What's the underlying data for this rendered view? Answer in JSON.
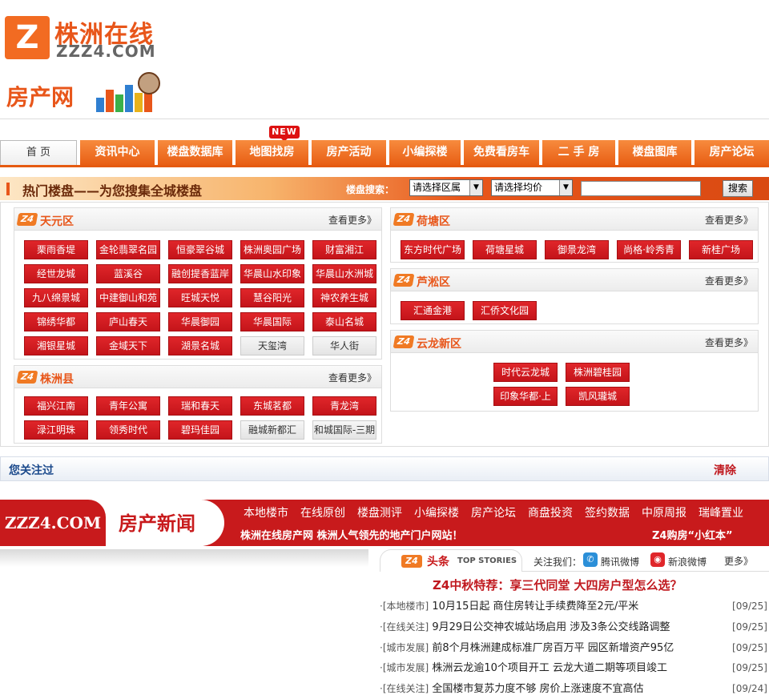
{
  "header": {
    "logo_cn": "株洲在线",
    "logo_en": "ZZZ4.COM",
    "logo_mark": "Z",
    "section_logo": "房产网"
  },
  "nav": {
    "home": "首 页",
    "new_badge": "NEW",
    "items": [
      "资讯中心",
      "楼盘数据库",
      "地图找房",
      "房产活动",
      "小编探楼",
      "免费看房车",
      "二 手 房",
      "楼盘图库",
      "房产论坛"
    ]
  },
  "hot": {
    "title": "热门楼盘——为您搜集全城楼盘",
    "search_label": "楼盘搜索：",
    "district_select": "请选择区属",
    "price_select": "请选择均价",
    "search_button": "搜索"
  },
  "districts": {
    "more_label": "查看更多》",
    "logo_mark": "Z4",
    "tianyuan": {
      "name": "天元区",
      "items": [
        {
          "label": "栗雨香堤",
          "style": "red"
        },
        {
          "label": "金轮翡翠名园",
          "style": "red"
        },
        {
          "label": "恒豪翠谷城",
          "style": "red"
        },
        {
          "label": "株洲奥园广场",
          "style": "red"
        },
        {
          "label": "财富湘江",
          "style": "red"
        },
        {
          "label": "经世龙城",
          "style": "red"
        },
        {
          "label": "蓝溪谷",
          "style": "red"
        },
        {
          "label": "融创提香蓝岸",
          "style": "red"
        },
        {
          "label": "华晨山水印象",
          "style": "red"
        },
        {
          "label": "华晨山水洲城",
          "style": "red"
        },
        {
          "label": "九八绵景城",
          "style": "red"
        },
        {
          "label": "中建御山和苑",
          "style": "red"
        },
        {
          "label": "旺城天悦",
          "style": "red"
        },
        {
          "label": "慧谷阳光",
          "style": "red"
        },
        {
          "label": "神农养生城",
          "style": "red"
        },
        {
          "label": "锦绣华都",
          "style": "red"
        },
        {
          "label": "庐山春天",
          "style": "red"
        },
        {
          "label": "华晨御园",
          "style": "red"
        },
        {
          "label": "华晨国际",
          "style": "red"
        },
        {
          "label": "泰山名城",
          "style": "red"
        },
        {
          "label": "湘银星城",
          "style": "red"
        },
        {
          "label": "金域天下",
          "style": "red"
        },
        {
          "label": "湖景名城",
          "style": "red"
        },
        {
          "label": "天玺湾",
          "style": "grey"
        },
        {
          "label": "华人街",
          "style": "grey"
        }
      ]
    },
    "zhuzhouxian": {
      "name": "株洲县",
      "items": [
        {
          "label": "福兴江南",
          "style": "red"
        },
        {
          "label": "青年公寓",
          "style": "red"
        },
        {
          "label": "瑞和春天",
          "style": "red"
        },
        {
          "label": "东城茗都",
          "style": "red"
        },
        {
          "label": "青龙湾",
          "style": "red"
        },
        {
          "label": "渌江明珠",
          "style": "red"
        },
        {
          "label": "领秀时代",
          "style": "red"
        },
        {
          "label": "碧玛佳园",
          "style": "red"
        },
        {
          "label": "融城新都汇",
          "style": "grey"
        },
        {
          "label": "和城国际-三期",
          "style": "grey"
        }
      ]
    },
    "hetang": {
      "name": "荷塘区",
      "items": [
        {
          "label": "东方时代广场",
          "style": "red"
        },
        {
          "label": "荷塘星城",
          "style": "red"
        },
        {
          "label": "御景龙湾",
          "style": "red"
        },
        {
          "label": "尚格·岭秀青",
          "style": "red"
        },
        {
          "label": "新桂广场",
          "style": "red"
        }
      ]
    },
    "lusong": {
      "name": "芦淞区",
      "items": [
        {
          "label": "汇通金港",
          "style": "red"
        },
        {
          "label": "汇侨文化园",
          "style": "red"
        }
      ]
    },
    "yunlong": {
      "name": "云龙新区",
      "items": [
        {
          "label": "时代云龙城",
          "style": "red"
        },
        {
          "label": "株洲碧桂园",
          "style": "red"
        },
        {
          "label": "印象华都·上",
          "style": "red"
        },
        {
          "label": "凯风瓏城",
          "style": "red"
        }
      ]
    }
  },
  "follow": {
    "title": "您关注过",
    "clear": "清除"
  },
  "news_banner": {
    "en": "ZZZ4.COM",
    "cn": "房产新闻",
    "links": [
      "本地楼市",
      "在线原创",
      "楼盘测评",
      "小编探楼",
      "房产论坛",
      "商盘投资",
      "签约数据",
      "中原周报",
      "瑞峰置业"
    ],
    "slogan": "株洲在线房产网 株洲人气领先的地产门户网站！",
    "right": "Z4购房“小红本”"
  },
  "headlines": {
    "logo_mark": "Z4",
    "title": "头条",
    "subtitle": "TOP STORIES",
    "follow_label": "关注我们：",
    "tencent": "腾讯微博",
    "sina": "新浪微博",
    "more": "更多》",
    "feature": "Z4中秋特荐：享三代同堂 大四房户型怎么选？",
    "items": [
      {
        "cat": "·[本地楼市]",
        "text": "10月15日起 商住房转让手续费降至2元/平米",
        "date": "[09/25]"
      },
      {
        "cat": "·[在线关注]",
        "text": "9月29日公交神农城站场启用 涉及3条公交线路调整",
        "date": "[09/25]"
      },
      {
        "cat": "·[城市发展]",
        "text": "前8个月株洲建成标准厂房百万平 园区新增资产95亿",
        "date": "[09/25]"
      },
      {
        "cat": "·[城市发展]",
        "text": "株洲云龙逾10个项目开工 云龙大道二期等项目竣工",
        "date": "[09/25]"
      },
      {
        "cat": "·[在线关注]",
        "text": "全国楼市复苏力度不够 房价上涨速度不宜高估",
        "date": "[09/24]"
      }
    ]
  }
}
